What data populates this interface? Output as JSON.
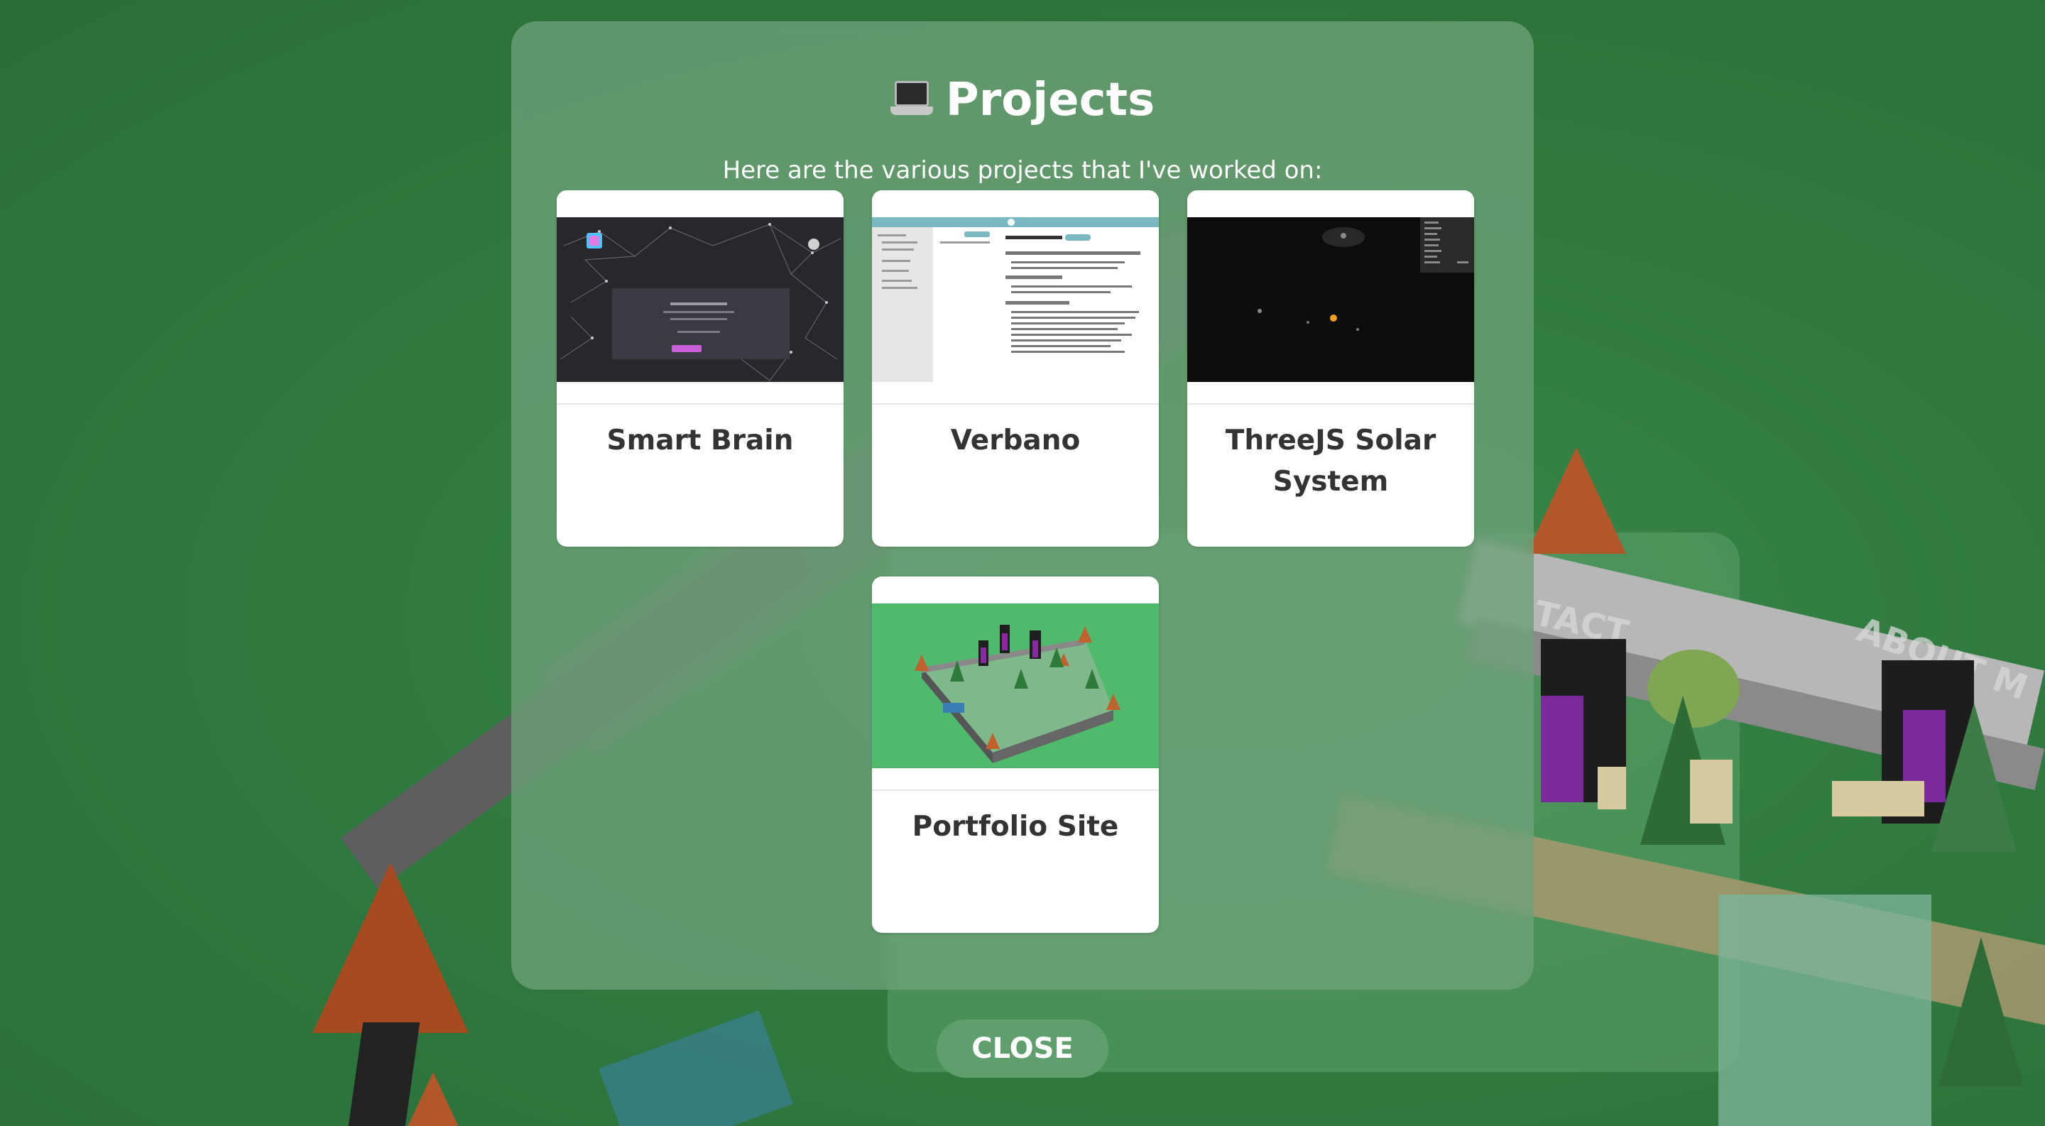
{
  "modal": {
    "title": "Projects",
    "title_icon": "laptop-icon",
    "subtitle": "Here are the various projects that I've worked on:",
    "background": "#6ea078"
  },
  "projects": [
    {
      "name": "Smart Brain",
      "thumbnail_icon": "smart-brain-screenshot"
    },
    {
      "name": "Verbano",
      "thumbnail_icon": "verbano-screenshot"
    },
    {
      "name": "ThreeJS Solar System",
      "thumbnail_icon": "solar-system-screenshot"
    },
    {
      "name": "Portfolio Site",
      "thumbnail_icon": "portfolio-site-screenshot"
    }
  ],
  "close_label": "CLOSE",
  "colors": {
    "scene_grass": "#2f7d3f",
    "card_background": "#ffffff",
    "card_text": "#333333",
    "close_button": "#5f9f6d"
  }
}
